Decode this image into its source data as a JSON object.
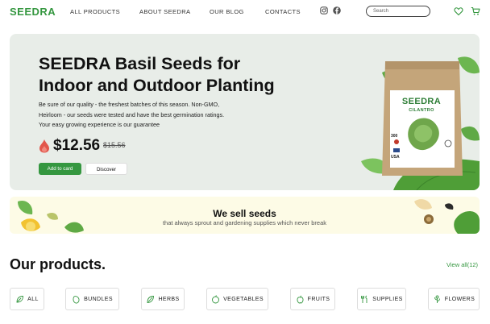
{
  "header": {
    "logo": "SEEDRA",
    "nav": [
      "ALL PRODUCTS",
      "ABOUT SEEDRA",
      "OUR BLOG",
      "CONTACTS"
    ],
    "search_placeholder": "Search",
    "social_icons": [
      "instagram-icon",
      "facebook-icon"
    ],
    "action_icons": [
      "heart-icon",
      "cart-icon"
    ]
  },
  "hero": {
    "title_line1": "SEEDRA Basil Seeds for",
    "title_line2": "Indoor and Outdoor Planting",
    "desc_line1": "Be sure of our quality - the freshest batches of this season. Non-GMO,",
    "desc_line2": "Heirloom - our seeds were tested and have the best germination ratings.",
    "desc_line3": "Your easy growing experience is our guarantee",
    "price": "$12.56",
    "old_price": "$15.56",
    "add_to_cart": "Add to card",
    "discover": "Discover",
    "pack_brand": "SEEDRA",
    "pack_sub": "CILANTRO",
    "pack_count": "300",
    "pack_origin": "USA"
  },
  "band": {
    "title": "We sell seeds",
    "subtitle": "that always sprout and gardening supplies which never break"
  },
  "products": {
    "title": "Our products.",
    "view_all": "View all(12)",
    "categories": [
      "ALL",
      "BUNDLES",
      "HERBS",
      "VEGETABLES",
      "FRUITS",
      "SUPPLIES",
      "FLOWERS"
    ]
  },
  "colors": {
    "brand_green": "#359740",
    "hero_bg": "#e8ede8",
    "band_bg": "#fdfbe6"
  }
}
